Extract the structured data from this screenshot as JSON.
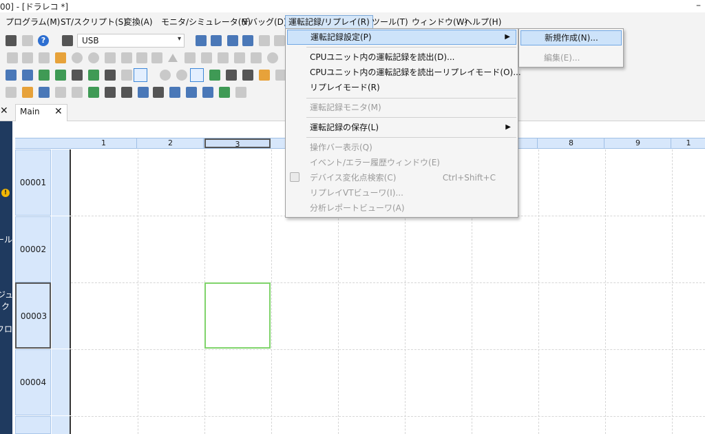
{
  "window": {
    "title": "00] - [ドラレコ *]",
    "minimize": "–"
  },
  "menubar": {
    "items": [
      {
        "label": "プログラム(M)"
      },
      {
        "label": "ST/スクリプト(S)"
      },
      {
        "label": "変換(A)"
      },
      {
        "label": "モニタ/シミュレータ(N)"
      },
      {
        "label": "デバッグ(D)"
      },
      {
        "label": "運転記録/リプレイ(R)",
        "active": true
      },
      {
        "label": "ツール(T)"
      },
      {
        "label": "ウィンドウ(W)"
      },
      {
        "label": "ヘルプ(H)"
      }
    ]
  },
  "toolbar": {
    "connection_select": "USB",
    "help_icon": "?"
  },
  "tabs": {
    "close_left": "✕",
    "main_label": "Main",
    "main_close": "✕"
  },
  "navpane": {
    "warning": "!",
    "texts": [
      "ール",
      "ジュ",
      "ク",
      "フロ"
    ]
  },
  "ladder": {
    "columns": [
      "1",
      "2",
      "3",
      "",
      "",
      "",
      "",
      "8",
      "9",
      "1"
    ],
    "selected_column": "3",
    "rows": [
      "00001",
      "00002",
      "00003",
      "00004"
    ],
    "selected_row": "00003"
  },
  "dropdown": {
    "items": [
      {
        "label": "運転記録設定(P)",
        "highlight": true,
        "submenu": true
      },
      {
        "label": "CPUユニット内の運転記録を読出(D)..."
      },
      {
        "label": "CPUユニット内の運転記録を読出ーリプレイモード(O)..."
      },
      {
        "label": "リプレイモード(R)"
      },
      {
        "label": "運転記録モニタ(M)",
        "disabled": true
      },
      {
        "label": "運転記録の保存(L)",
        "submenu": true
      },
      {
        "label": "操作バー表示(Q)",
        "disabled": true
      },
      {
        "label": "イベント/エラー履歴ウィンドウ(E)",
        "disabled": true
      },
      {
        "label": "デバイス変化点検索(C)",
        "disabled": true,
        "shortcut": "Ctrl+Shift+C"
      },
      {
        "label": "リプレイVTビューワ(I)...",
        "disabled": true
      },
      {
        "label": "分析レポートビューワ(A)",
        "disabled": true
      }
    ],
    "submenu_arrow": "▶"
  },
  "submenu": {
    "items": [
      {
        "label": "新規作成(N)...",
        "highlight": true
      },
      {
        "label": "編集(E)...",
        "disabled": true
      }
    ]
  }
}
